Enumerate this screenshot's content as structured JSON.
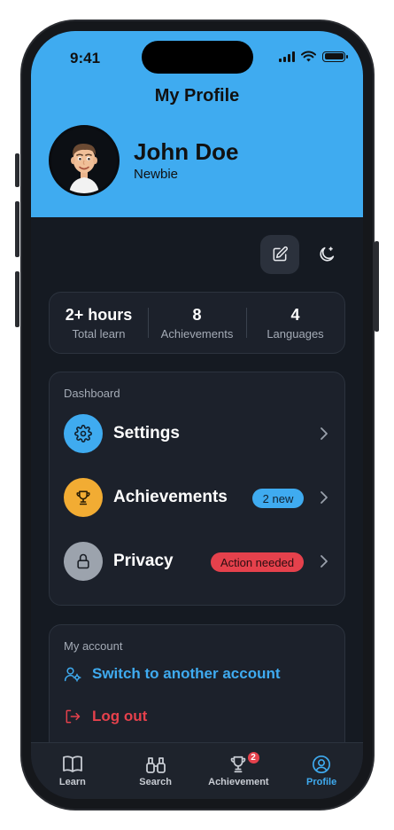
{
  "status_bar": {
    "time": "9:41"
  },
  "header": {
    "title": "My Profile"
  },
  "profile": {
    "name": "John Doe",
    "rank": "Newbie",
    "avatar_icon": "memoji-avatar"
  },
  "actions": {
    "edit_icon": "edit-icon",
    "theme_icon": "moon-icon"
  },
  "stats": [
    {
      "value": "2+ hours",
      "label": "Total learn"
    },
    {
      "value": "8",
      "label": "Achievements"
    },
    {
      "value": "4",
      "label": "Languages"
    }
  ],
  "dashboard": {
    "label": "Dashboard",
    "items": [
      {
        "label": "Settings",
        "icon": "gear-icon",
        "color": "#3fabf0",
        "badge": ""
      },
      {
        "label": "Achievements",
        "icon": "trophy-icon",
        "color": "#f2ac33",
        "badge": "2 new"
      },
      {
        "label": "Privacy",
        "icon": "lock-icon",
        "color": "#9ca3ad",
        "badge": "Action needed"
      }
    ]
  },
  "account": {
    "label": "My account",
    "switch_label": "Switch to another account",
    "logout_label": "Log out"
  },
  "tabs": [
    {
      "label": "Learn",
      "icon": "book-icon",
      "active": false
    },
    {
      "label": "Search",
      "icon": "binoculars-icon",
      "active": false
    },
    {
      "label": "Achievement",
      "icon": "trophy-icon",
      "active": false,
      "badge": "2"
    },
    {
      "label": "Profile",
      "icon": "user-circle-icon",
      "active": true
    }
  ],
  "colors": {
    "accent": "#3fabf0",
    "danger": "#e5414c",
    "warning": "#f2ac33",
    "background": "#151a22"
  }
}
